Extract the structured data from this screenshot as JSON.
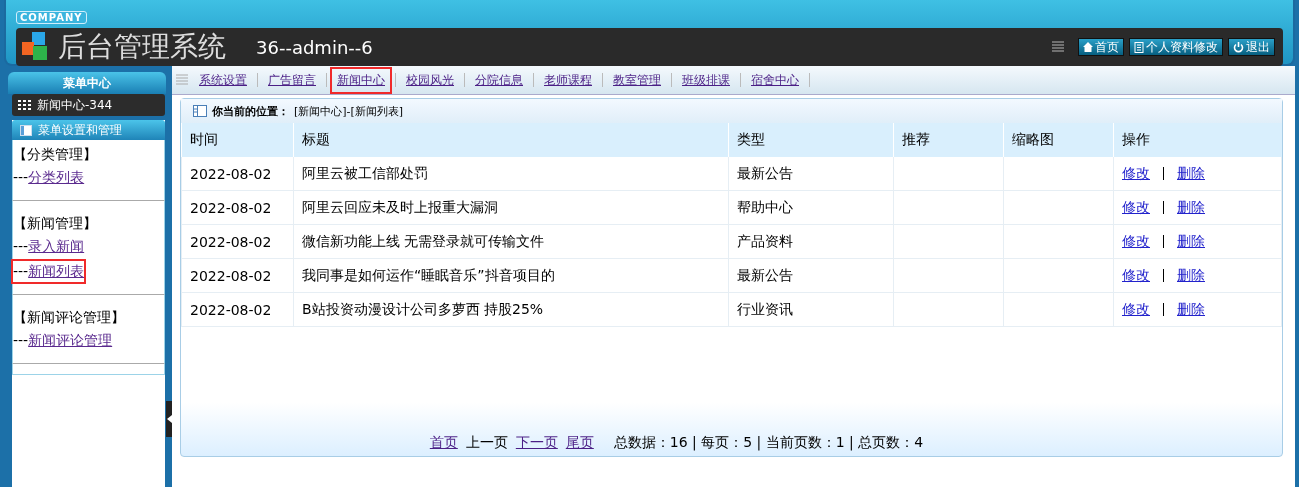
{
  "header": {
    "badge": "COMPANY",
    "title": "后台管理系统",
    "user": "36--admin--6",
    "buttons": [
      {
        "kind": "home",
        "label": "首页"
      },
      {
        "kind": "profile",
        "label": "个人资料修改"
      },
      {
        "kind": "logout",
        "label": "退出"
      }
    ]
  },
  "sidebar": {
    "title": "菜单中心",
    "current": "新闻中心-344",
    "panel_title": "菜单设置和管理",
    "groups": [
      {
        "heading": "【分类管理】",
        "links": [
          {
            "prefix": "---",
            "label": "分类列表",
            "highlighted": false
          }
        ]
      },
      {
        "heading": "【新闻管理】",
        "links": [
          {
            "prefix": "---",
            "label": "录入新闻",
            "highlighted": false
          },
          {
            "prefix": "---",
            "label": "新闻列表",
            "highlighted": true
          }
        ]
      },
      {
        "heading": "【新闻评论管理】",
        "links": [
          {
            "prefix": "---",
            "label": "新闻评论管理",
            "highlighted": false
          }
        ]
      }
    ]
  },
  "tabs": [
    {
      "label": "系统设置",
      "highlighted": false
    },
    {
      "label": "广告留言",
      "highlighted": false
    },
    {
      "label": "新闻中心",
      "highlighted": true
    },
    {
      "label": "校园风光",
      "highlighted": false
    },
    {
      "label": "分院信息",
      "highlighted": false
    },
    {
      "label": "老师课程",
      "highlighted": false
    },
    {
      "label": "教室管理",
      "highlighted": false
    },
    {
      "label": "班级排课",
      "highlighted": false
    },
    {
      "label": "宿舍中心",
      "highlighted": false
    }
  ],
  "breadcrumb": {
    "label": "你当前的位置：",
    "path": "[新闻中心]-[新闻列表]"
  },
  "table": {
    "columns": [
      "时间",
      "标题",
      "类型",
      "推荐",
      "缩略图",
      "操作"
    ],
    "rows": [
      {
        "date": "2022-08-02",
        "title": "阿里云被工信部处罚",
        "type": "最新公告",
        "edit": "修改",
        "delete": "删除"
      },
      {
        "date": "2022-08-02",
        "title": "阿里云回应未及时上报重大漏洞",
        "type": "帮助中心",
        "edit": "修改",
        "delete": "删除"
      },
      {
        "date": "2022-08-02",
        "title": "微信新功能上线 无需登录就可传输文件",
        "type": "产品资料",
        "edit": "修改",
        "delete": "删除"
      },
      {
        "date": "2022-08-02",
        "title": "我同事是如何运作“睡眠音乐”抖音项目的",
        "type": "最新公告",
        "edit": "修改",
        "delete": "删除"
      },
      {
        "date": "2022-08-02",
        "title": "B站投资动漫设计公司多萝西 持股25%",
        "type": "行业资讯",
        "edit": "修改",
        "delete": "删除"
      }
    ]
  },
  "pagination": {
    "links": [
      {
        "label": "首页",
        "disabled": false
      },
      {
        "label": "上一页",
        "disabled": true
      },
      {
        "label": "下一页",
        "disabled": false
      },
      {
        "label": "尾页",
        "disabled": false
      }
    ],
    "summary": "总数据：16 | 每页：5 | 当前页数：1 | 总页数：4"
  }
}
